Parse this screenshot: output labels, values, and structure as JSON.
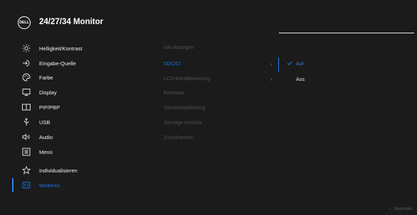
{
  "header": {
    "logo_text": "DELL",
    "title": "24/27/34 Monitor"
  },
  "left_menu": [
    {
      "id": "brightness",
      "label": "Helligkeit/Kontrast",
      "icon": "brightness-icon"
    },
    {
      "id": "input",
      "label": "Eingabe-Quelle",
      "icon": "input-source-icon"
    },
    {
      "id": "color",
      "label": "Farbe",
      "icon": "palette-icon"
    },
    {
      "id": "display",
      "label": "Display",
      "icon": "display-icon"
    },
    {
      "id": "pip",
      "label": "PIP/PBP",
      "icon": "pip-pbp-icon"
    },
    {
      "id": "usb",
      "label": "USB",
      "icon": "usb-icon"
    },
    {
      "id": "audio",
      "label": "Audio",
      "icon": "audio-icon"
    },
    {
      "id": "menu",
      "label": "Menü",
      "icon": "menu-icon"
    },
    {
      "id": "personalize",
      "label": "Individualisieren",
      "icon": "star-icon"
    },
    {
      "id": "others",
      "label": "Weiteres",
      "icon": "others-icon",
      "selected": true
    }
  ],
  "sub_menu": [
    {
      "label": "Info Anzeigen",
      "chevron": false
    },
    {
      "label": "DDC/CI",
      "chevron": true,
      "active": true
    },
    {
      "label": "LCD-Konditionierung",
      "chevron": true
    },
    {
      "label": "Firmware",
      "chevron": false
    },
    {
      "label": "Servicemarkierung",
      "chevron": false
    },
    {
      "label": "Sonstige zurücks.",
      "chevron": false
    },
    {
      "label": "Zurücksetzen",
      "chevron": false
    }
  ],
  "chevron_glyph": "›",
  "options": [
    {
      "label": "Auf",
      "checked": true
    },
    {
      "label": "Aus",
      "checked": false
    }
  ],
  "footer": {
    "back_glyph": "‹",
    "exit_label": "Beenden"
  },
  "colors": {
    "accent": "#2f7ee8",
    "background": "#1b1b1b",
    "dim_text": "#525252"
  }
}
